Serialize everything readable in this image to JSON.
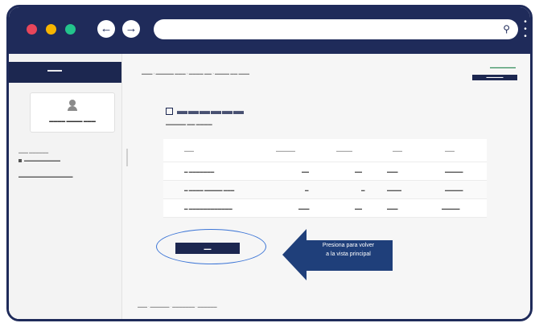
{
  "window": {
    "dots": [
      "#e8465b",
      "#f7b500",
      "#23c48c"
    ],
    "url_text": ""
  },
  "callout": {
    "line1": "Presiona para volver",
    "line2": "a la vista principal"
  },
  "colors": {
    "chrome": "#1f2b5a",
    "accent": "#1c2750",
    "oval": "#3c75d6",
    "callout": "#1f3f7a"
  }
}
